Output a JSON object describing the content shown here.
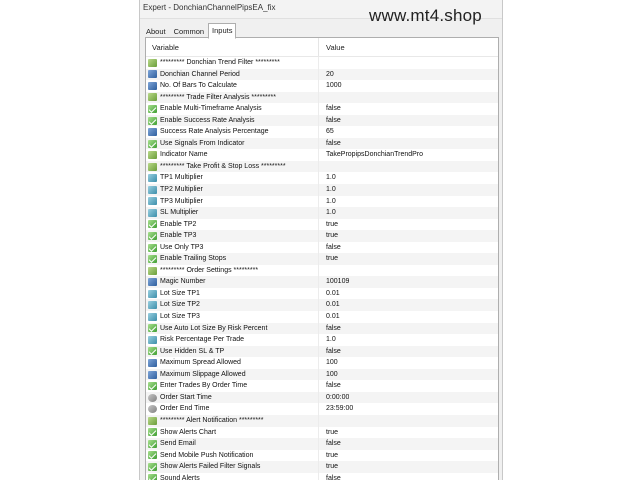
{
  "window": {
    "title": "Expert - DonchianChannelPipsEA_fix"
  },
  "watermark": "www.mt4.shop",
  "tabs": [
    {
      "label": "About"
    },
    {
      "label": "Common"
    },
    {
      "label": "Inputs",
      "active": true
    }
  ],
  "table": {
    "headers": {
      "variable": "Variable",
      "value": "Value"
    },
    "rows": [
      {
        "icon": "ab",
        "name": "********* Donchian Trend Filter *********",
        "value": ""
      },
      {
        "icon": "num",
        "name": "Donchian Channel Period",
        "value": "20"
      },
      {
        "icon": "num",
        "name": "No. Of Bars To Calculate",
        "value": "1000"
      },
      {
        "icon": "ab",
        "name": "********* Trade Filter Analysis *********",
        "value": ""
      },
      {
        "icon": "bool",
        "name": "Enable Multi-Timeframe Analysis",
        "value": "false"
      },
      {
        "icon": "bool",
        "name": "Enable Success Rate Analysis",
        "value": "false"
      },
      {
        "icon": "num",
        "name": "Success Rate Analysis Percentage",
        "value": "65"
      },
      {
        "icon": "bool",
        "name": "Use Signals From Indicator",
        "value": "false"
      },
      {
        "icon": "ab",
        "name": "Indicator Name",
        "value": "TakePropipsDonchianTrendPro"
      },
      {
        "icon": "ab",
        "name": "********* Take Profit & Stop Loss *********",
        "value": ""
      },
      {
        "icon": "dbl",
        "name": "TP1 Multiplier",
        "value": "1.0"
      },
      {
        "icon": "dbl",
        "name": "TP2 Multiplier",
        "value": "1.0"
      },
      {
        "icon": "dbl",
        "name": "TP3 Multiplier",
        "value": "1.0"
      },
      {
        "icon": "dbl",
        "name": "SL Multiplier",
        "value": "1.0"
      },
      {
        "icon": "bool",
        "name": "Enable TP2",
        "value": "true"
      },
      {
        "icon": "bool",
        "name": "Enable TP3",
        "value": "true"
      },
      {
        "icon": "bool",
        "name": "Use Only TP3",
        "value": "false"
      },
      {
        "icon": "bool",
        "name": "Enable Trailing Stops",
        "value": "true"
      },
      {
        "icon": "ab",
        "name": "********* Order Settings *********",
        "value": ""
      },
      {
        "icon": "num",
        "name": "Magic Number",
        "value": "100109"
      },
      {
        "icon": "dbl",
        "name": "Lot Size TP1",
        "value": "0.01"
      },
      {
        "icon": "dbl",
        "name": "Lot Size TP2",
        "value": "0.01"
      },
      {
        "icon": "dbl",
        "name": "Lot Size TP3",
        "value": "0.01"
      },
      {
        "icon": "bool",
        "name": "Use Auto Lot Size By Risk Percent",
        "value": "false"
      },
      {
        "icon": "dbl",
        "name": "Risk Percentage Per Trade",
        "value": "1.0"
      },
      {
        "icon": "bool",
        "name": "Use Hidden SL & TP",
        "value": "false"
      },
      {
        "icon": "num",
        "name": "Maximum Spread Allowed",
        "value": "100"
      },
      {
        "icon": "num",
        "name": "Maximum Slippage Allowed",
        "value": "100"
      },
      {
        "icon": "bool",
        "name": "Enter Trades By Order Time",
        "value": "false"
      },
      {
        "icon": "time",
        "name": "Order Start Time",
        "value": "0:00:00"
      },
      {
        "icon": "time",
        "name": "Order End Time",
        "value": "23:59:00"
      },
      {
        "icon": "ab",
        "name": "********* Alert Notification *********",
        "value": ""
      },
      {
        "icon": "bool",
        "name": "Show Alerts Chart",
        "value": "true"
      },
      {
        "icon": "bool",
        "name": "Send Email",
        "value": "false"
      },
      {
        "icon": "bool",
        "name": "Send Mobile Push Notification",
        "value": "true"
      },
      {
        "icon": "bool",
        "name": "Show Alerts Failed Filter Signals",
        "value": "true"
      },
      {
        "icon": "bool",
        "name": "Sound Alerts",
        "value": "false"
      }
    ]
  }
}
